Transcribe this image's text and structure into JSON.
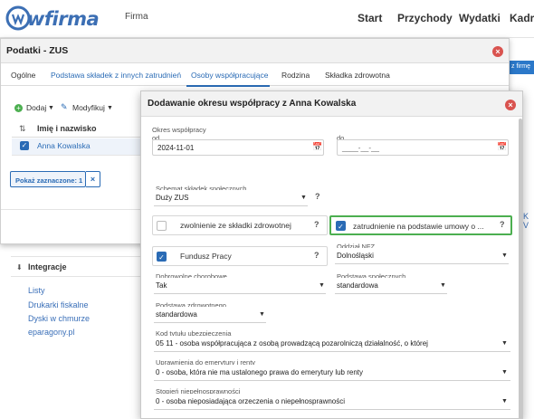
{
  "topbar": {
    "logo": "wfirma",
    "brand_menu": "Firma",
    "nav": [
      "Start",
      "Przychody",
      "Wydatki",
      "Kadry"
    ]
  },
  "background": {
    "integracje_title": "Integracje",
    "links": [
      "Listy",
      "Drukarki fiskalne",
      "Dyski w chmurze",
      "eparagony.pl"
    ],
    "right_button": "z firmę",
    "right_link": "K V"
  },
  "podatki_dialog": {
    "title": "Podatki - ZUS",
    "tabs": [
      "Ogólne",
      "Podstawa składek z innych zatrudnień",
      "Osoby współpracujące",
      "Rodzina",
      "Składka zdrowotna"
    ],
    "active_tab": "Osoby współpracujące",
    "toolbar": {
      "dodaj": "Dodaj",
      "modyfikuj": "Modyfikuj"
    },
    "column_header": "Imię i nazwisko",
    "rows": [
      "Anna Kowalska"
    ],
    "show_selected": "Pokaż zaznaczone: 1"
  },
  "period_dialog": {
    "title": "Dodawanie okresu współpracy z Anna Kowalska",
    "okres_label": "Okres współpracy",
    "od_label": "od",
    "od_value": "2024-11-01",
    "do_label": "do",
    "do_placeholder": "____-__-__",
    "schemat_label": "Schemat składek społecznych",
    "schemat_value": "Duży ZUS",
    "zwolnienie_label": "zwolnienie ze składki zdrowotnej",
    "zwolnienie_checked": false,
    "zatrudnienie_label": "zatrudnienie na podstawie umowy o ...",
    "zatrudnienie_checked": true,
    "fundusz_label": "Fundusz Pracy",
    "fundusz_checked": true,
    "oddzial_label": "Oddział NFZ",
    "oddzial_value": "Dolnośląski",
    "dobrowolne_label": "Dobrowolne chorobowe",
    "dobrowolne_value": "Tak",
    "podstawa_spol_label": "Podstawa społecznych",
    "podstawa_spol_value": "standardowa",
    "podstawa_zdr_label": "Podstawa zdrowotnego",
    "podstawa_zdr_value": "standardowa",
    "kod_label": "Kod tytułu ubezpieczenia",
    "kod_value": "05 11 - osoba współpracująca z osobą prowadzącą pozarolniczą działalność, o której",
    "emerytura_label": "Uprawnienia do emerytury i renty",
    "emerytura_value": "0 - osoba, która nie ma ustalonego prawa do emerytury lub renty",
    "stopien_label": "Stopień niepełnosprawności",
    "stopien_value": "0 - osoba nieposiadająca orzeczenia o niepełnosprawności"
  },
  "colors": {
    "accent": "#2a6bb5",
    "close": "#d9534f",
    "highlight": "#4caf50"
  }
}
